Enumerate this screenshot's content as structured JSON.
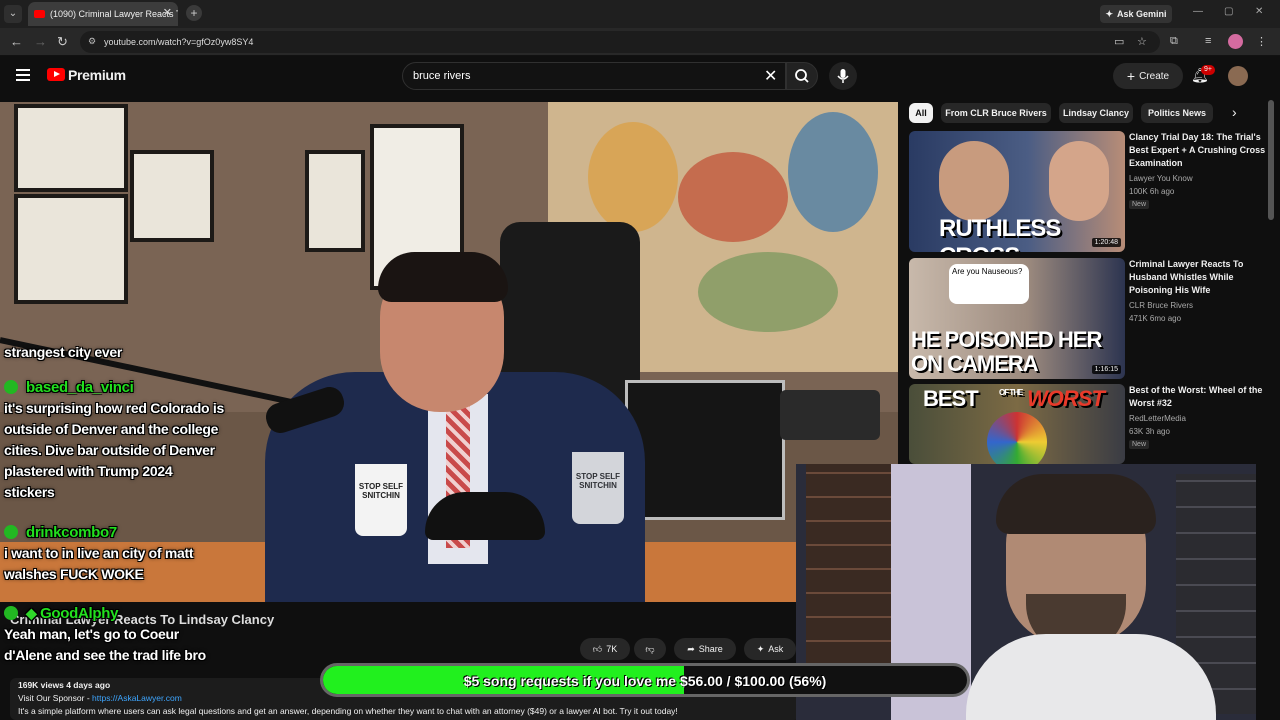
{
  "browser": {
    "tab_title": "(1090) Criminal Lawyer Reacts T",
    "url": "youtube.com/watch?v=gfOz0yw8SY4",
    "gemini_label": "Ask Gemini"
  },
  "youtube": {
    "logo_label": "Premium",
    "search_value": "bruce rivers",
    "create_label": "Create",
    "notif_badge": "9+"
  },
  "chips": [
    "All",
    "From CLR Bruce Rivers",
    "Lindsay Clancy",
    "Politics News"
  ],
  "chat": {
    "partial_top": "strangest city ever",
    "messages": [
      {
        "user": "based_da_vinci",
        "lines": [
          "it's surprising how red Colorado is",
          "outside of Denver and the college",
          "cities. Dive bar outside of Denver",
          "plastered with Trump 2024",
          "stickers"
        ]
      },
      {
        "user": "drinkcombo7",
        "lines": [
          "i want to in live an city of matt",
          "walshes FUCK WOKE"
        ]
      },
      {
        "user": "GoodAlphy",
        "lines": [
          "Yeah man, let's go to Coeur",
          "d'Alene and see the trad life bro"
        ]
      }
    ]
  },
  "video": {
    "title": "Criminal Lawyer Reacts To Lindsay Clancy",
    "mug_text": "STOP SELF SNITCHIN",
    "likes": "7K",
    "share_label": "Share",
    "ask_label": "Ask",
    "views_line": "169K views  4 days ago",
    "sponsor_prefix": "Visit Our Sponsor - ",
    "sponsor_link": "https://AskaLawyer.com",
    "description": "It's a simple platform where users can ask legal questions and get an answer, depending on whether they want to chat with an attorney ($49) or a lawyer AI bot. Try it out today!"
  },
  "recommendations": [
    {
      "title": "Clancy Trial Day 18: The Trial's Best Expert + A Crushing Cross Examination",
      "channel": "Lawyer You Know",
      "stats": "100K  6h ago",
      "new": "New",
      "duration": "1:20:48",
      "thumb_text": "RUTHLESS CROSS"
    },
    {
      "title": "Criminal Lawyer Reacts To Husband Whistles While Poisoning His Wife",
      "channel": "CLR Bruce Rivers",
      "stats": "471K  6mo ago",
      "new": "",
      "duration": "1:16:15",
      "thumb_text_1": "HE POISONED HER",
      "thumb_text_2": "ON CAMERA",
      "bubble": "Are you Nauseous?"
    },
    {
      "title": "Best of the Worst: Wheel of the Worst #32",
      "channel": "RedLetterMedia",
      "stats": "63K  3h ago",
      "new": "New",
      "thumb_text_1": "BEST",
      "thumb_text_2": "WORST",
      "thumb_small": "OF THE"
    }
  ],
  "goal": {
    "text": "$5 song requests if you love me $56.00 / $100.00 (56%)",
    "progress": 0.56
  },
  "colors": {
    "accent_red": "#ff0000",
    "goal_green": "#21f01e",
    "chat_name": "#22e01e",
    "link": "#3ea6ff"
  }
}
